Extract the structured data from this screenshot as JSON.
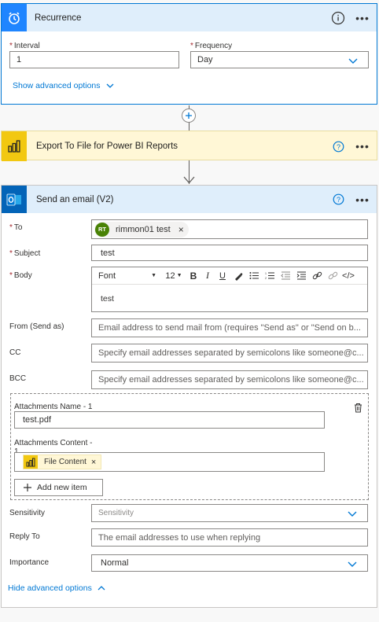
{
  "recurrence": {
    "title": "Recurrence",
    "interval_label": "Interval",
    "interval_value": "1",
    "frequency_label": "Frequency",
    "frequency_value": "Day",
    "advanced_link": "Show advanced options"
  },
  "export": {
    "title": "Export To File for Power BI Reports"
  },
  "email": {
    "title": "Send an email (V2)",
    "to_label": "To",
    "to_chip_initials": "RT",
    "to_chip_name": "rimmon01 test",
    "subject_label": "Subject",
    "subject_value": "test",
    "body_label": "Body",
    "body_font": "Font",
    "body_size": "12",
    "body_text": "test",
    "from_label": "From (Send as)",
    "from_placeholder": "Email address to send mail from (requires \"Send as\" or \"Send on b...",
    "cc_label": "CC",
    "cc_placeholder": "Specify email addresses separated by semicolons like someone@c...",
    "bcc_label": "BCC",
    "bcc_placeholder": "Specify email addresses separated by semicolons like someone@c...",
    "attach_name_label": "Attachments Name - 1",
    "attach_name_value": "test.pdf",
    "attach_content_label": "Attachments Content -",
    "attach_content_label_2": "1",
    "attach_content_token": "File Content",
    "add_item_label": "Add new item",
    "sensitivity_label": "Sensitivity",
    "sensitivity_placeholder": "Sensitivity",
    "reply_label": "Reply To",
    "reply_placeholder": "The email addresses to use when replying",
    "importance_label": "Importance",
    "importance_value": "Normal",
    "hide_link": "Hide advanced options"
  },
  "colors": {
    "accent": "#0078d4",
    "recurrence_tile": "#1f85ff",
    "powerbi_tile": "#f2c811",
    "outlook_tile": "#0364b8",
    "required": "#a4262c",
    "chip_avatar": "#498205"
  },
  "icons": {
    "recurrence": "alarm-clock-icon",
    "powerbi": "power-bi-icon",
    "outlook": "outlook-icon",
    "info": "info-icon",
    "help": "help-circle-icon",
    "more": "ellipsis-icon",
    "add_step": "plus-circle-icon"
  }
}
